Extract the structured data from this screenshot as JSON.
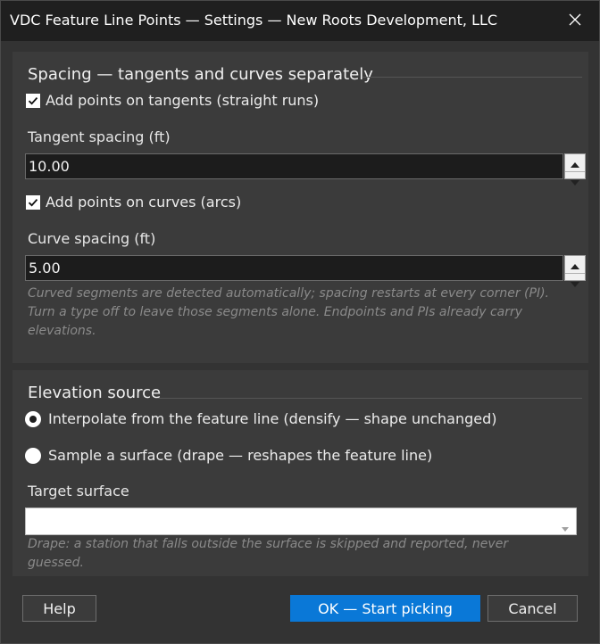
{
  "window": {
    "title": "VDC Feature Line Points — Settings — New Roots Development, LLC"
  },
  "spacing": {
    "heading": "Spacing — tangents and curves separately",
    "tangents_check": {
      "label": "Add points on tangents (straight runs)",
      "checked": true
    },
    "tangent_spacing_label": "Tangent spacing (ft)",
    "tangent_spacing_value": "10.00",
    "curves_check": {
      "label": "Add points on curves (arcs)",
      "checked": true
    },
    "curve_spacing_label": "Curve spacing (ft)",
    "curve_spacing_value": "5.00",
    "help_lines": [
      "Curved segments are detected automatically; spacing restarts at every corner (PI).",
      "Turn a type off to leave those segments alone. Endpoints and PIs already carry",
      "elevations."
    ]
  },
  "elevation": {
    "heading": "Elevation source",
    "option_interpolate": {
      "label": "Interpolate from the feature line (densify — shape unchanged)",
      "selected": true
    },
    "option_surface": {
      "label": "Sample a surface (drape — reshapes the feature line)",
      "selected": false
    },
    "target_surface_label": "Target surface",
    "target_surface_value": "",
    "help": "Drape: a station that falls outside the surface is skipped and reported, never guessed."
  },
  "buttons": {
    "help": "Help",
    "ok": "OK — Start picking",
    "cancel": "Cancel"
  },
  "colors": {
    "accent": "#0a78d7",
    "window_bg": "#333333",
    "group_bg": "#3b3b3b",
    "titlebar_bg": "#1f1f1f"
  },
  "icons": {
    "close": "close-icon",
    "spin_up": "chevron-up-icon",
    "spin_down": "chevron-down-icon",
    "dropdown": "chevron-down-icon"
  }
}
